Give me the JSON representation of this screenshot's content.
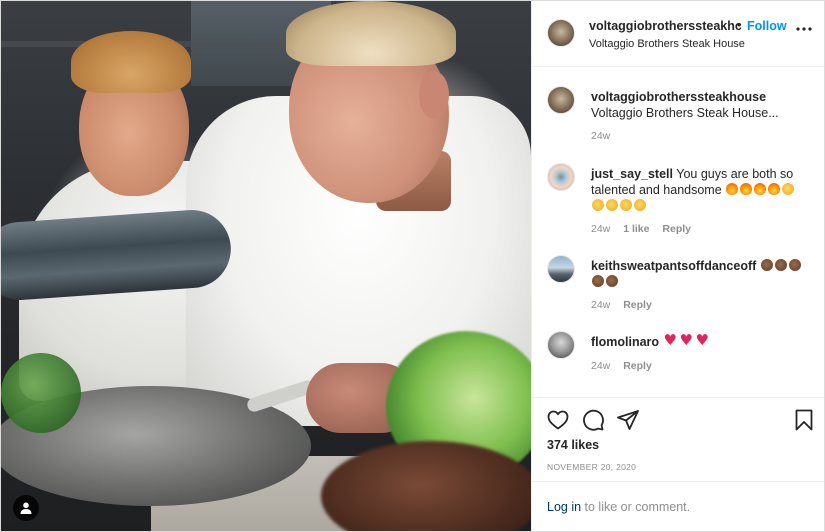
{
  "post": {
    "author_username": "voltaggiobrotherssteakhc",
    "separator": "•",
    "follow_label": "Follow",
    "location": "Voltaggio Brothers Steak House",
    "more_icon": "more-horizontal-icon"
  },
  "comments": [
    {
      "username": "voltaggiobrotherssteakhouse",
      "text": "Voltaggio Brothers Steak House...",
      "age": "24w",
      "likes": "",
      "reply_label": ""
    },
    {
      "username": "just_say_stell",
      "text": "You guys are both so talented and handsome",
      "emoji": [
        "fire",
        "fire",
        "fire",
        "fire",
        "clap",
        "clap",
        "clap",
        "clap",
        "clap"
      ],
      "age": "24w",
      "likes": "1 like",
      "reply_label": "Reply"
    },
    {
      "username": "keithsweatpantsoffdanceoff",
      "text": "",
      "emoji": [
        "clap-dark",
        "clap-dark",
        "clap-dark",
        "clap-dark",
        "clap-dark"
      ],
      "age": "24w",
      "likes": "",
      "reply_label": "Reply"
    },
    {
      "username": "flomolinaro",
      "text": "",
      "emoji": [
        "heart",
        "heart",
        "heart"
      ],
      "age": "24w",
      "likes": "",
      "reply_label": "Reply"
    }
  ],
  "actions": {
    "like_icon": "heart-outline-icon",
    "comment_icon": "comment-icon",
    "share_icon": "paper-plane-icon",
    "save_icon": "bookmark-icon",
    "likes_count": "374 likes",
    "date": "NOVEMBER 20, 2020"
  },
  "footer": {
    "login_link": "Log in",
    "login_rest": " to like or comment."
  },
  "colors": {
    "accent": "#0095f6",
    "text": "#262626",
    "muted": "#8e8e8e",
    "link_dark": "#00376b"
  }
}
